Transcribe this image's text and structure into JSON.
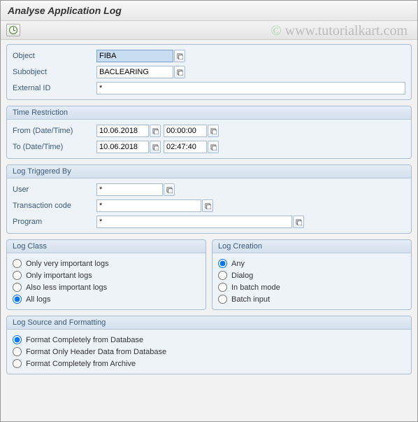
{
  "title": "Analyse Application Log",
  "watermark": {
    "prefix": "©",
    "text": " www.tutorialkart.com"
  },
  "topFields": {
    "object_label": "Object",
    "object_value": "FIBA",
    "subobject_label": "Subobject",
    "subobject_value": "BACLEARING",
    "extid_label": "External ID",
    "extid_value": "*"
  },
  "timeRestriction": {
    "title": "Time Restriction",
    "from_label": "From (Date/Time)",
    "from_date": "10.06.2018",
    "from_time": "00:00:00",
    "to_label": "To (Date/Time)",
    "to_date": "10.06.2018",
    "to_time": "02:47:40"
  },
  "triggeredBy": {
    "title": "Log Triggered By",
    "user_label": "User",
    "user_value": "*",
    "tcode_label": "Transaction code",
    "tcode_value": "*",
    "program_label": "Program",
    "program_value": "*"
  },
  "logClass": {
    "title": "Log Class",
    "options": {
      "very_important": "Only very important logs",
      "important": "Only important logs",
      "less_important": "Also less important logs",
      "all": "All logs"
    },
    "selected": "all"
  },
  "logCreation": {
    "title": "Log Creation",
    "options": {
      "any": "Any",
      "dialog": "Dialog",
      "batch": "In batch mode",
      "batch_input": "Batch input"
    },
    "selected": "any"
  },
  "sourceFormat": {
    "title": "Log Source and Formatting",
    "options": {
      "db_full": "Format Completely from Database",
      "db_header": "Format Only Header Data from Database",
      "archive": "Format Completely from Archive"
    },
    "selected": "db_full"
  }
}
